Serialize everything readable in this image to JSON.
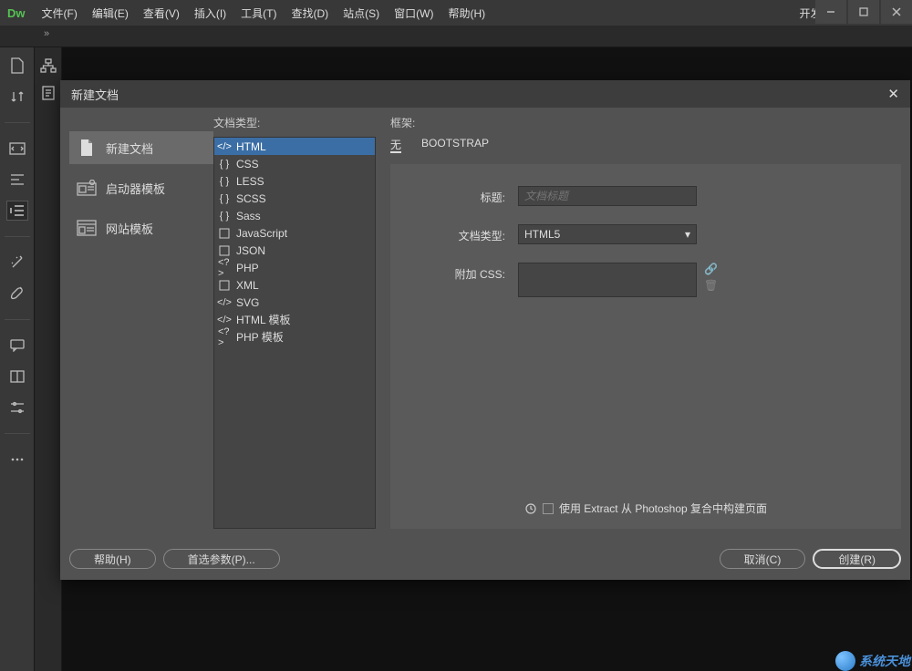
{
  "titlebar": {
    "logo": "Dw",
    "menus": [
      "文件(F)",
      "编辑(E)",
      "查看(V)",
      "插入(I)",
      "工具(T)",
      "查找(D)",
      "站点(S)",
      "窗口(W)",
      "帮助(H)"
    ],
    "dev_label": "开发人员"
  },
  "dialog": {
    "title": "新建文档",
    "categories": [
      {
        "label": "新建文档",
        "selected": true
      },
      {
        "label": "启动器模板",
        "selected": false
      },
      {
        "label": "网站模板",
        "selected": false
      }
    ],
    "type_heading": "文档类型:",
    "doc_types": [
      {
        "label": "HTML",
        "icon": "code",
        "selected": true
      },
      {
        "label": "CSS",
        "icon": "braces",
        "selected": false
      },
      {
        "label": "LESS",
        "icon": "braces",
        "selected": false
      },
      {
        "label": "SCSS",
        "icon": "braces",
        "selected": false
      },
      {
        "label": "Sass",
        "icon": "braces",
        "selected": false
      },
      {
        "label": "JavaScript",
        "icon": "js",
        "selected": false
      },
      {
        "label": "JSON",
        "icon": "json",
        "selected": false
      },
      {
        "label": "PHP",
        "icon": "php",
        "selected": false
      },
      {
        "label": "XML",
        "icon": "xml",
        "selected": false
      },
      {
        "label": "SVG",
        "icon": "svg",
        "selected": false
      },
      {
        "label": "HTML 模板",
        "icon": "tpl",
        "selected": false
      },
      {
        "label": "PHP 模板",
        "icon": "tpl",
        "selected": false
      }
    ],
    "frame_heading": "框架:",
    "frame_tabs": [
      {
        "label": "无",
        "active": true
      },
      {
        "label": "BOOTSTRAP",
        "active": false
      }
    ],
    "form": {
      "title_label": "标题:",
      "title_placeholder": "文档标题",
      "doctype_label": "文档类型:",
      "doctype_value": "HTML5",
      "css_label": "附加 CSS:",
      "extract_label": "使用 Extract 从 Photoshop 复合中构建页面"
    },
    "buttons": {
      "help": "帮助(H)",
      "prefs": "首选参数(P)...",
      "cancel": "取消(C)",
      "create": "创建(R)"
    }
  },
  "watermark": "系统天地"
}
